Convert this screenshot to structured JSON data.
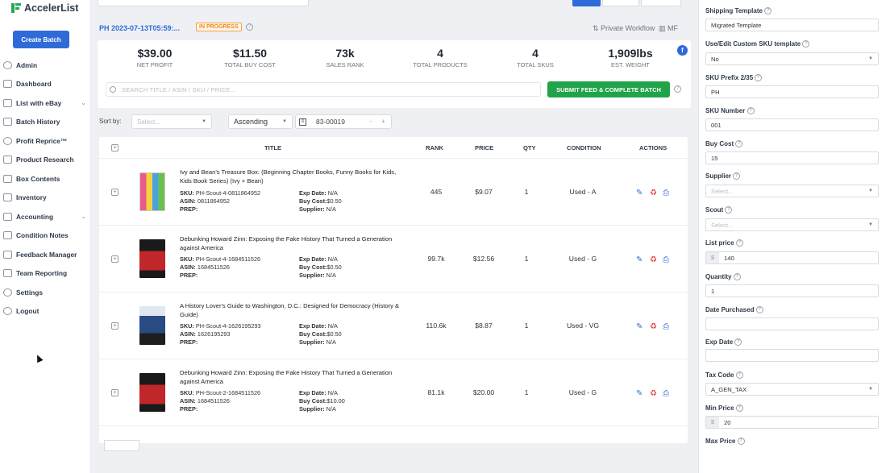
{
  "app": {
    "logo": "AccelerList",
    "create_batch": "Create Batch"
  },
  "sidebar": {
    "items": [
      {
        "label": "Admin",
        "icon": "users-icon",
        "chev": false
      },
      {
        "label": "Dashboard",
        "icon": "home-icon",
        "chev": false
      },
      {
        "label": "List with eBay",
        "icon": "ebay-icon",
        "chev": true
      },
      {
        "label": "Batch History",
        "icon": "history-icon",
        "chev": false
      },
      {
        "label": "Profit Reprice™",
        "icon": "reprice-icon",
        "chev": false
      },
      {
        "label": "Product Research",
        "icon": "flask-icon",
        "chev": false
      },
      {
        "label": "Box Contents",
        "icon": "box-icon",
        "chev": false
      },
      {
        "label": "Inventory",
        "icon": "inventory-icon",
        "chev": false
      },
      {
        "label": "Accounting",
        "icon": "accounting-icon",
        "chev": true
      },
      {
        "label": "Condition Notes",
        "icon": "notes-icon",
        "chev": false
      },
      {
        "label": "Feedback Manager",
        "icon": "feedback-icon",
        "chev": false
      },
      {
        "label": "Team Reporting",
        "icon": "team-icon",
        "chev": false
      },
      {
        "label": "Settings",
        "icon": "gear-icon",
        "chev": false
      },
      {
        "label": "Logout",
        "icon": "logout-icon",
        "chev": false
      }
    ]
  },
  "header": {
    "batch_title": "PH 2023-07-13T05:59:...",
    "status": "IN PROGRESS",
    "workflow": "Private Workflow",
    "mf": "MF"
  },
  "stats": [
    {
      "value": "$39.00",
      "label": "NET PROFIT"
    },
    {
      "value": "$11.50",
      "label": "TOTAL BUY COST"
    },
    {
      "value": "73k",
      "label": "SALES RANK"
    },
    {
      "value": "4",
      "label": "TOTAL PRODUCTS"
    },
    {
      "value": "4",
      "label": "TOTAL SKUS"
    },
    {
      "value": "1,909lbs",
      "label": "EST. WEIGHT"
    }
  ],
  "search": {
    "placeholder": "SEARCH TITLE / ASIN / SKU / PRICE..."
  },
  "submit_label": "SUBMIT FEED & COMPLETE BATCH",
  "sort": {
    "label": "Sort by:",
    "select_placeholder": "Select...",
    "order": "Ascending",
    "page_value": "83-00019",
    "minus": "-",
    "plus": "+"
  },
  "table": {
    "headers": {
      "title": "TITLE",
      "rank": "RANK",
      "price": "PRICE",
      "qty": "QTY",
      "condition": "CONDITION",
      "actions": "ACTIONS"
    },
    "rows": [
      {
        "title": "Ivy and Bean's Treasure Box: (Beginning Chapter Books, Funny Books for Kids, Kids Book Series) (Ivy + Bean)",
        "sku": "PH-Scout-4-0811864952",
        "asin": "0811864952",
        "prep": "",
        "exp": "N/A",
        "buy": "$0.50",
        "supplier": "N/A",
        "rank": "445",
        "price": "$9.07",
        "qty": "1",
        "condition": "Used - A"
      },
      {
        "title": "Debunking Howard Zinn: Exposing the Fake History That Turned a Generation against America",
        "sku": "PH-Scout-4-1684511526",
        "asin": "1684511526",
        "prep": "",
        "exp": "N/A",
        "buy": "$0.50",
        "supplier": "N/A",
        "rank": "99.7k",
        "price": "$12.56",
        "qty": "1",
        "condition": "Used - G"
      },
      {
        "title": "A History Lover's Guide to Washington, D.C.: Designed for Democracy (History & Guide)",
        "sku": "PH-Scout-4-1626195293",
        "asin": "1626195293",
        "prep": "",
        "exp": "N/A",
        "buy": "$0.50",
        "supplier": "N/A",
        "rank": "110.6k",
        "price": "$8.87",
        "qty": "1",
        "condition": "Used - VG"
      },
      {
        "title": "Debunking Howard Zinn: Exposing the Fake History That Turned a Generation against America",
        "sku": "PH-Scout-2-1684511526",
        "asin": "1684511526",
        "prep": "",
        "exp": "N/A",
        "buy": "$10.00",
        "supplier": "N/A",
        "rank": "81.1k",
        "price": "$20.00",
        "qty": "1",
        "condition": "Used - G"
      }
    ],
    "labels": {
      "sku": "SKU:",
      "asin": "ASIN:",
      "prep": "PREP:",
      "exp": "Exp Date:",
      "buy": "Buy Cost:",
      "supplier": "Supplier:"
    }
  },
  "panel": {
    "fields": [
      {
        "label": "Shipping Template",
        "value": "Migrated Template",
        "type": "text"
      },
      {
        "label": "Use/Edit Custom SKU template",
        "value": "No",
        "type": "select"
      },
      {
        "label": "SKU Prefix 2/35",
        "value": "PH",
        "type": "text"
      },
      {
        "label": "SKU Number",
        "value": "001",
        "type": "text"
      },
      {
        "label": "Buy Cost",
        "value": "15",
        "type": "text"
      },
      {
        "label": "Supplier",
        "value": "Select...",
        "type": "select-ph"
      },
      {
        "label": "Scout",
        "value": "Select...",
        "type": "select-ph"
      },
      {
        "label": "List price",
        "value": "140",
        "type": "money"
      },
      {
        "label": "Quantity",
        "value": "1",
        "type": "text"
      },
      {
        "label": "Date Purchased",
        "value": "",
        "type": "text"
      },
      {
        "label": "Exp Date",
        "value": "",
        "type": "text"
      },
      {
        "label": "Tax Code",
        "value": "A_GEN_TAX",
        "type": "select"
      },
      {
        "label": "Min Price",
        "value": "20",
        "type": "money"
      },
      {
        "label": "Max Price",
        "value": "",
        "type": "none"
      }
    ],
    "currency": "$"
  }
}
